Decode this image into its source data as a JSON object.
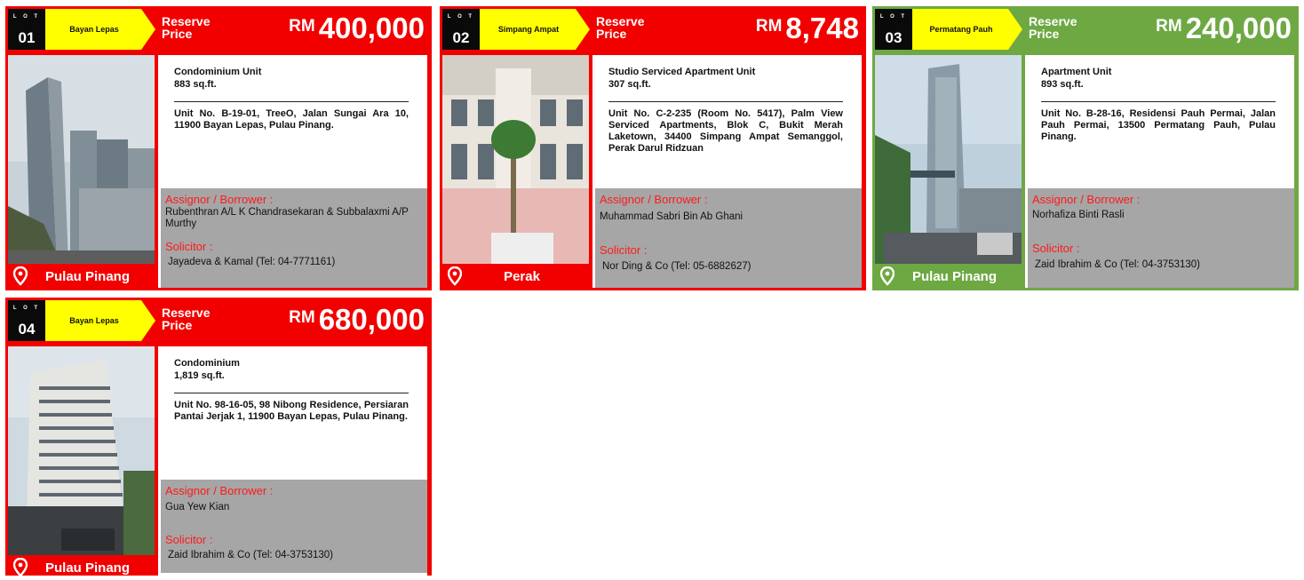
{
  "labels": {
    "lot": "L O T",
    "reserve_price": "Reserve Price",
    "currency": "RM",
    "assignor": "Assignor / Borrower :",
    "solicitor": "Solicitor :"
  },
  "lots": [
    {
      "lot_no": "01",
      "area": "Bayan Lepas",
      "price": "400,000",
      "type": "Condominium Unit",
      "size": "883 sq.ft.",
      "address": "Unit No. B-19-01, TreeO, Jalan Sungai Ara 10, 11900 Bayan Lepas, Pulau Pinang.",
      "assignor": "Rubenthran A/L K Chandrasekaran & Subbalaxmi A/P Murthy",
      "solicitor": "Jayadeva & Kamal (Tel: 04-7771161)",
      "state": "Pulau Pinang",
      "theme_color": "#f20000"
    },
    {
      "lot_no": "02",
      "area": "Simpang Ampat",
      "price": "8,748",
      "type": "Studio Serviced Apartment Unit",
      "size": "307 sq.ft.",
      "address": "Unit No. C-2-235 (Room No. 5417), Palm View Serviced Apartments, Blok C, Bukit Merah Laketown, 34400 Simpang Ampat Semanggol, Perak Darul Ridzuan",
      "assignor": "Muhammad Sabri Bin Ab Ghani",
      "solicitor": "Nor Ding & Co (Tel: 05-6882627)",
      "state": "Perak",
      "theme_color": "#f20000"
    },
    {
      "lot_no": "03",
      "area": "Permatang Pauh",
      "price": "240,000",
      "type": "Apartment Unit",
      "size": "893 sq.ft.",
      "address": "Unit No. B-28-16, Residensi Pauh Permai, Jalan Pauh Permai, 13500 Permatang Pauh, Pulau Pinang.",
      "assignor": "Norhafiza Binti Rasli",
      "solicitor": "Zaid Ibrahim & Co (Tel: 04-3753130)",
      "state": "Pulau Pinang",
      "theme_color": "#6ea843"
    },
    {
      "lot_no": "04",
      "area": "Bayan Lepas",
      "price": "680,000",
      "type": "Condominium",
      "size": "1,819 sq.ft.",
      "address": "Unit No. 98-16-05, 98 Nibong Residence, Persiaran Pantai Jerjak 1, 11900 Bayan Lepas, Pulau Pinang.",
      "assignor": "Gua Yew Kian",
      "solicitor": "Zaid Ibrahim & Co (Tel: 04-3753130)",
      "state": "Pulau Pinang",
      "theme_color": "#f20000"
    }
  ]
}
